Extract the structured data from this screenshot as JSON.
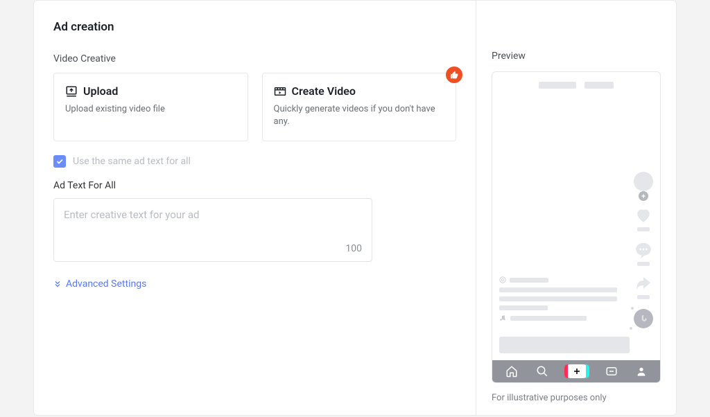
{
  "title": "Ad creation",
  "video_creative": {
    "label": "Video Creative",
    "upload": {
      "title": "Upload",
      "desc": "Upload existing video file"
    },
    "create": {
      "title": "Create Video",
      "desc": "Quickly generate videos if you don't have any."
    }
  },
  "same_text": {
    "checked": true,
    "label": "Use the same ad text for all"
  },
  "ad_text": {
    "label": "Ad Text For All",
    "placeholder": "Enter creative text for your ad",
    "value": "",
    "counter": "100"
  },
  "advanced_settings_label": "Advanced Settings",
  "preview": {
    "label": "Preview",
    "footnote": "For illustrative purposes only"
  }
}
